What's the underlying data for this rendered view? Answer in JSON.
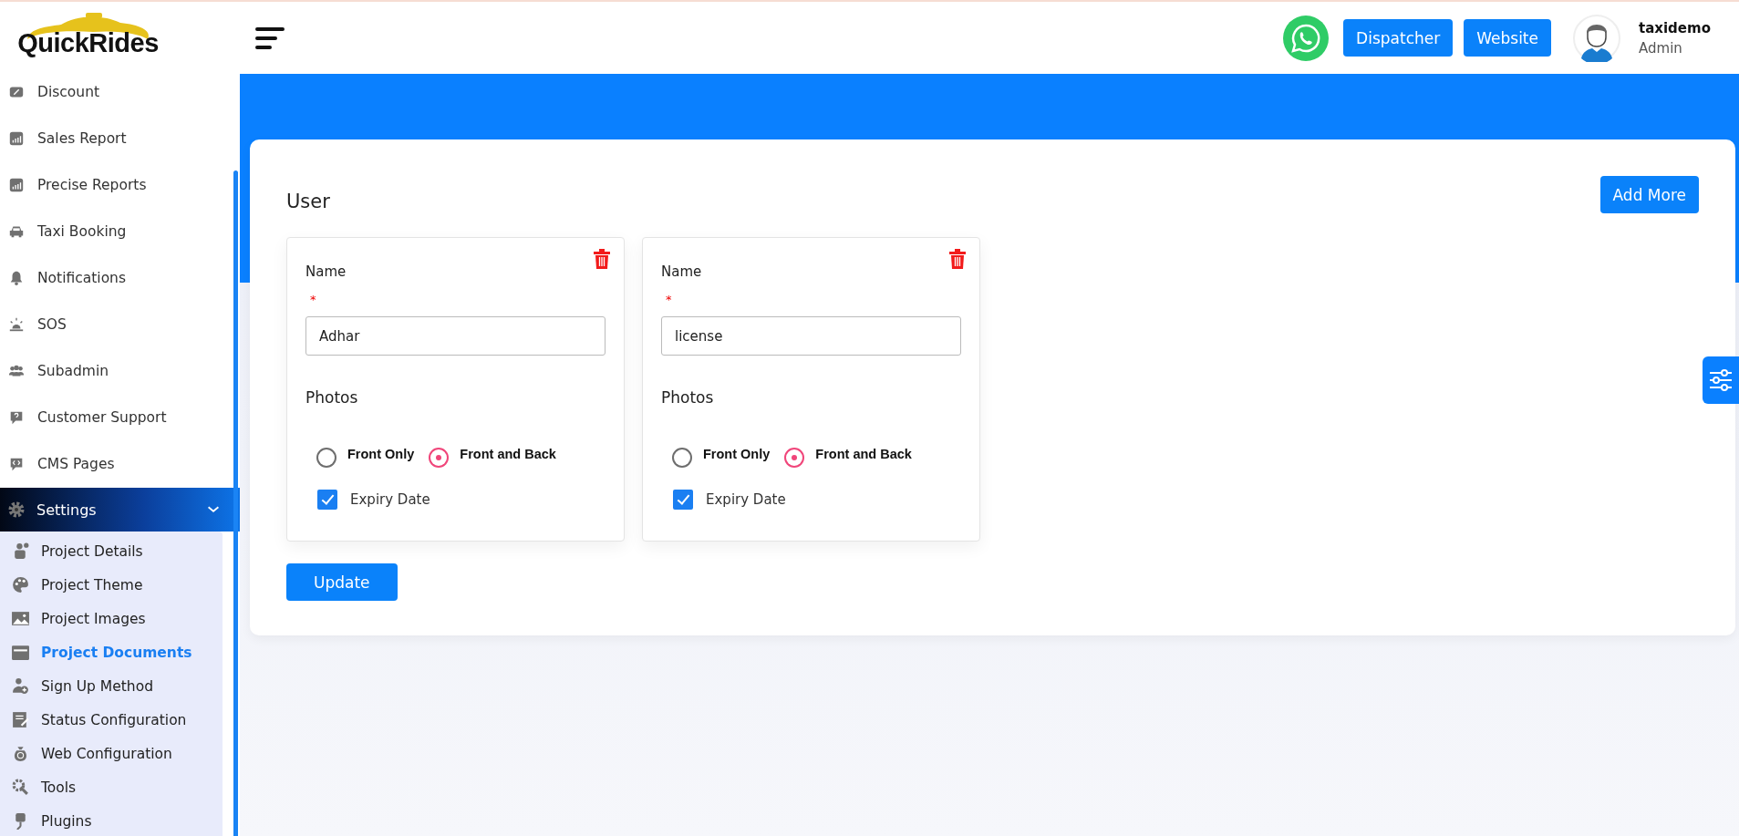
{
  "logo": {
    "text": "QuickRides"
  },
  "sidebar": {
    "items": [
      {
        "label": "Discount"
      },
      {
        "label": "Sales Report"
      },
      {
        "label": "Precise Reports"
      },
      {
        "label": "Taxi Booking"
      },
      {
        "label": "Notifications"
      },
      {
        "label": "SOS"
      },
      {
        "label": "Subadmin"
      },
      {
        "label": "Customer Support"
      },
      {
        "label": "CMS Pages"
      }
    ],
    "settings": {
      "label": "Settings",
      "expanded": true,
      "children": [
        {
          "label": "Project Details",
          "selected": false
        },
        {
          "label": "Project Theme",
          "selected": false
        },
        {
          "label": "Project Images",
          "selected": false
        },
        {
          "label": "Project Documents",
          "selected": true
        },
        {
          "label": "Sign Up Method",
          "selected": false
        },
        {
          "label": "Status Configuration",
          "selected": false
        },
        {
          "label": "Web Configuration",
          "selected": false
        },
        {
          "label": "Tools",
          "selected": false
        },
        {
          "label": "Plugins",
          "selected": false
        }
      ]
    }
  },
  "header": {
    "buttons": [
      "Dispatcher",
      "Website"
    ],
    "user": {
      "name": "taxidemo",
      "role": "Admin"
    }
  },
  "section": {
    "title": "User",
    "add_button": "Add More",
    "cards": [
      {
        "label": "Name",
        "required_mark": "*",
        "value": "Adhar",
        "photos_label": "Photos",
        "options": [
          {
            "label": "Front Only",
            "selected": false
          },
          {
            "label": "Front and Back",
            "selected": true
          }
        ],
        "expiry": {
          "label": "Expiry Date",
          "checked": true
        }
      },
      {
        "label": "Name",
        "required_mark": "*",
        "value": "license",
        "photos_label": "Photos",
        "options": [
          {
            "label": "Front Only",
            "selected": false
          },
          {
            "label": "Front and Back",
            "selected": true
          }
        ],
        "expiry": {
          "label": "Expiry Date",
          "checked": true
        }
      }
    ],
    "update_button": "Update"
  }
}
